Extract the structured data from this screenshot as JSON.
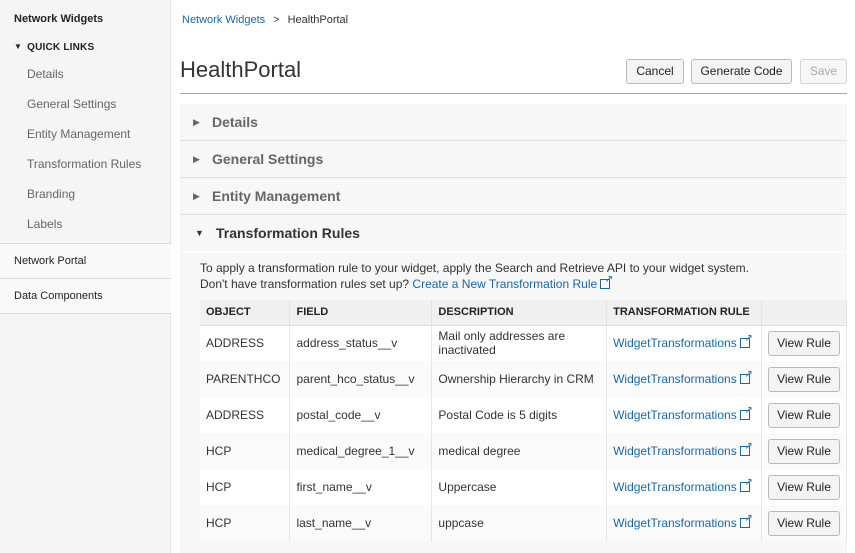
{
  "sidebar": {
    "title": "Network Widgets",
    "quick_links_label": "QUICK LINKS",
    "quick_links": [
      "Details",
      "General Settings",
      "Entity Management",
      "Transformation Rules",
      "Branding",
      "Labels"
    ],
    "sections": [
      "Network Portal",
      "Data Components"
    ]
  },
  "breadcrumb": {
    "parent": "Network Widgets",
    "separator": ">",
    "current": "HealthPortal"
  },
  "header": {
    "title": "HealthPortal",
    "cancel_label": "Cancel",
    "generate_label": "Generate Code",
    "save_label": "Save"
  },
  "accordion": {
    "details": "Details",
    "general_settings": "General Settings",
    "entity_management": "Entity Management",
    "transformation_rules": "Transformation Rules"
  },
  "transformation": {
    "intro": "To apply a transformation rule to your widget, apply the Search and Retrieve API to your widget system.",
    "question": "Don't have transformation rules set up?",
    "create_link": "Create a New Transformation Rule",
    "columns": [
      "OBJECT",
      "FIELD",
      "DESCRIPTION",
      "TRANSFORMATION RULE",
      ""
    ],
    "rows": [
      {
        "object": "ADDRESS",
        "field": "address_status__v",
        "description": "Mail only addresses are inactivated",
        "rule": "WidgetTransformations",
        "action": "View Rule"
      },
      {
        "object": "PARENTHCO",
        "field": "parent_hco_status__v",
        "description": "Ownership Hierarchy in CRM",
        "rule": "WidgetTransformations",
        "action": "View Rule"
      },
      {
        "object": "ADDRESS",
        "field": "postal_code__v",
        "description": "Postal Code is 5 digits",
        "rule": "WidgetTransformations",
        "action": "View Rule"
      },
      {
        "object": "HCP",
        "field": "medical_degree_1__v",
        "description": "medical degree",
        "rule": "WidgetTransformations",
        "action": "View Rule"
      },
      {
        "object": "HCP",
        "field": "first_name__v",
        "description": "Uppercase",
        "rule": "WidgetTransformations",
        "action": "View Rule"
      },
      {
        "object": "HCP",
        "field": "last_name__v",
        "description": "uppcase",
        "rule": "WidgetTransformations",
        "action": "View Rule"
      }
    ]
  },
  "icons": {
    "collapsed": "triangle-right-icon",
    "expanded": "triangle-down-icon",
    "external_link": "external-link-icon"
  },
  "colors": {
    "link": "#1a66a8",
    "title_rule": "#d9a54b",
    "sidebar_bg": "#f5f5f5"
  }
}
